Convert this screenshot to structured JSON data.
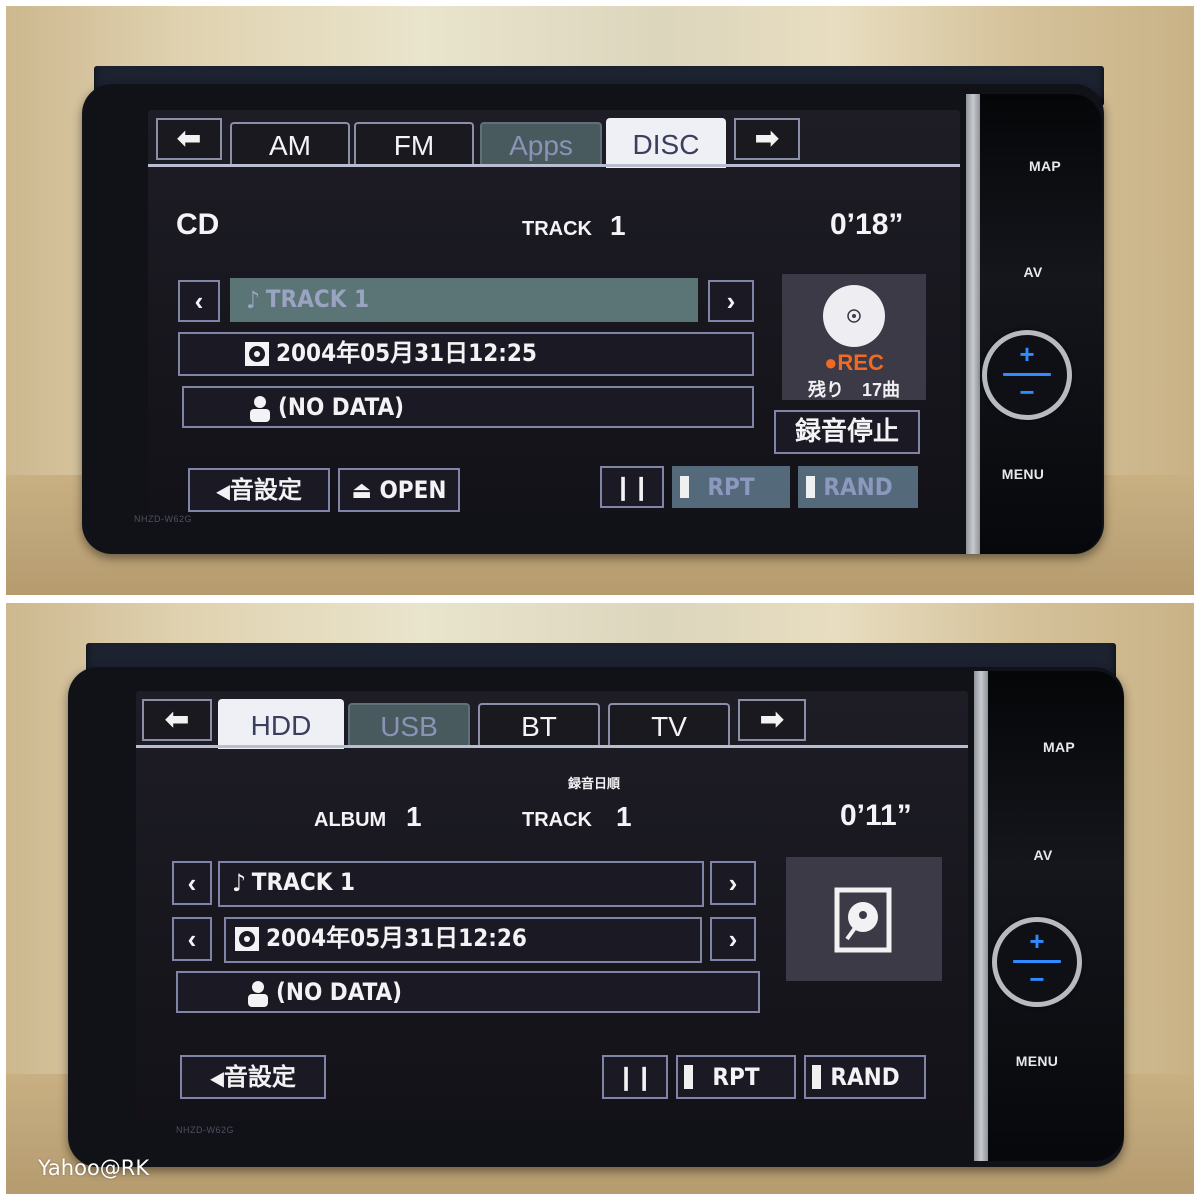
{
  "watermark": "Yahoo@RK",
  "device": {
    "model_label": "NHZD-W62G",
    "hardware_buttons": {
      "map": "MAP",
      "av": "AV",
      "menu": "MENU",
      "volume_up": "+",
      "volume_down": "−"
    }
  },
  "screen1": {
    "tabs": [
      {
        "label": "AM",
        "state": "normal"
      },
      {
        "label": "FM",
        "state": "normal"
      },
      {
        "label": "Apps",
        "state": "disabled"
      },
      {
        "label": "DISC",
        "state": "active"
      }
    ],
    "source": "CD",
    "track_label": "TRACK",
    "track_number": "1",
    "elapsed_time": "0’18”",
    "track_title": "TRACK  1",
    "recording_date": "2004年05月31日12:25",
    "artist": "(NO DATA)",
    "rec_indicator": "REC",
    "rec_color": "#f26a22",
    "remaining": "残り　17曲",
    "stop_recording_button": "録音停止",
    "sound_settings_button": "音設定",
    "open_button": "OPEN",
    "pause_icon": "pause-icon",
    "repeat_button": "RPT",
    "random_button": "RAND",
    "repeat_on": false,
    "random_on": false
  },
  "screen2": {
    "tabs": [
      {
        "label": "HDD",
        "state": "active"
      },
      {
        "label": "USB",
        "state": "disabled"
      },
      {
        "label": "BT",
        "state": "normal"
      },
      {
        "label": "TV",
        "state": "normal"
      }
    ],
    "sort_order": "録音日順",
    "album_label": "ALBUM",
    "album_number": "1",
    "track_label": "TRACK",
    "track_number": "1",
    "elapsed_time": "0’11”",
    "track_title": "TRACK  1",
    "recording_date": "2004年05月31日12:26",
    "artist": "(NO DATA)",
    "sound_settings_button": "音設定",
    "pause_icon": "pause-icon",
    "repeat_button": "RPT",
    "random_button": "RAND",
    "repeat_on": true,
    "random_on": true
  }
}
